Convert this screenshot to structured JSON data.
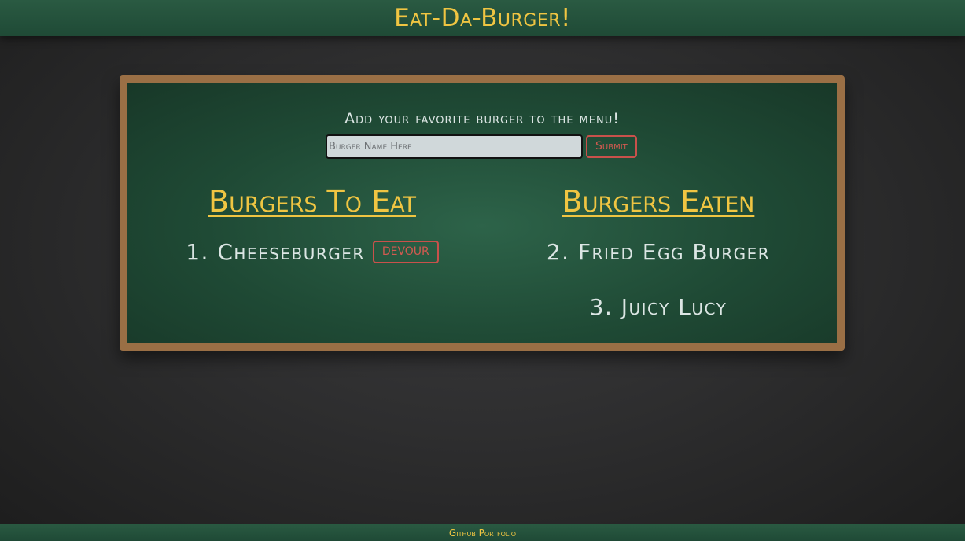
{
  "header": {
    "title": "Eat-Da-Burger!"
  },
  "form": {
    "prompt": "Add your favorite burger to the menu!",
    "input_placeholder": "Burger Name Here",
    "input_value": "",
    "submit_label": "Submit"
  },
  "to_eat": {
    "heading": "Burgers To Eat",
    "items": [
      {
        "number": "1.",
        "name": "Cheeseburger",
        "button_label": "devour"
      }
    ]
  },
  "eaten": {
    "heading": "Burgers Eaten",
    "items": [
      {
        "number": "2.",
        "name": "Fried Egg Burger"
      },
      {
        "number": "3.",
        "name": "Juicy Lucy"
      }
    ]
  },
  "footer": {
    "link_label": "Github Portfolio"
  },
  "colors": {
    "header_bg": "#2a5a42",
    "title_yellow": "#f0c542",
    "board_frame": "#9a6f45",
    "board_green": "#2d6349",
    "button_red": "#d25a50"
  }
}
